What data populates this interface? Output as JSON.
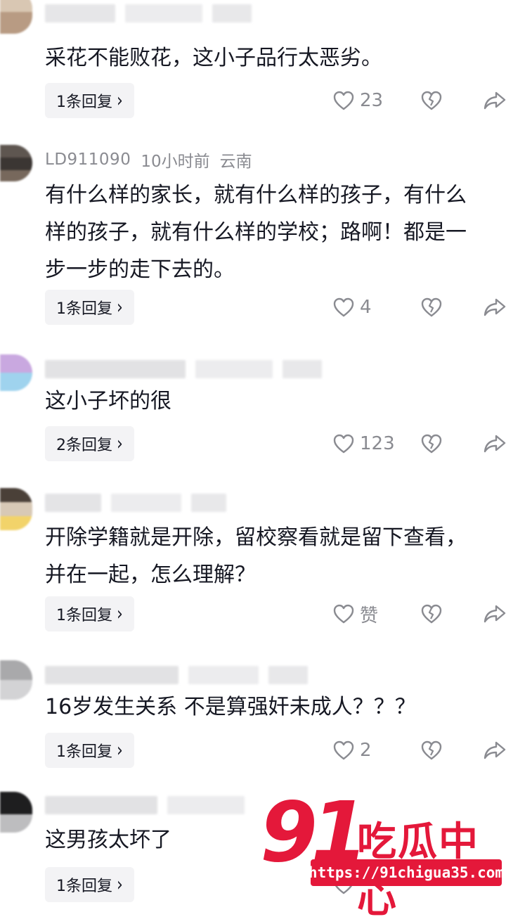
{
  "comments": [
    {
      "username": "",
      "time": "",
      "location": "",
      "text": "采花不能败花，这小子品行太恶劣。",
      "reply_label": "1条回复",
      "likes": "23"
    },
    {
      "username": "LD911090",
      "time": "10小时前",
      "location": "云南",
      "text": "有什么样的家长，就有什么样的孩子，有什么样的孩子，就有什么样的学校；路啊！都是一步一步的走下去的。",
      "reply_label": "1条回复",
      "likes": "4"
    },
    {
      "username": "",
      "time": "",
      "location": "",
      "text": "这小子坏的很",
      "reply_label": "2条回复",
      "likes": "123"
    },
    {
      "username": "",
      "time": "",
      "location": "",
      "text": "开除学籍就是开除，留校察看就是留下查看，并在一起，怎么理解？",
      "reply_label": "1条回复",
      "likes": "赞"
    },
    {
      "username": "",
      "time": "",
      "location": "",
      "text": "16岁发生关系 不是算强奸未成人？？？",
      "reply_label": "1条回复",
      "likes": "2"
    },
    {
      "username": "",
      "time": "",
      "location": "",
      "text": "这男孩太坏了",
      "reply_label": "1条回复",
      "likes": ""
    }
  ],
  "watermark": {
    "number": "91",
    "name": "吃瓜中心",
    "url": "https://91chigua35.com"
  },
  "icons": {
    "like": "heart-outline-icon",
    "dislike": "broken-heart-icon",
    "share": "share-arrow-icon"
  },
  "colors": {
    "text": "#161823",
    "muted": "#8a8b91",
    "reply_bg": "#f3f3f5",
    "watermark_red": "#e4183a"
  }
}
